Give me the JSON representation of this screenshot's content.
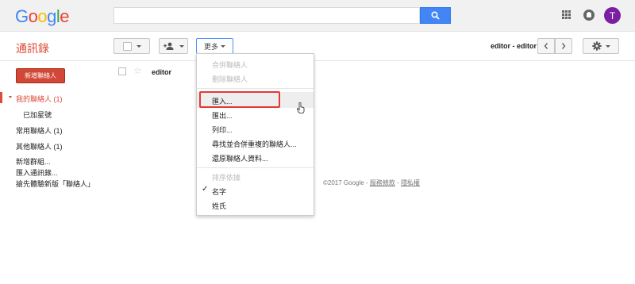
{
  "header": {
    "logo": [
      "G",
      "o",
      "o",
      "g",
      "l",
      "e"
    ],
    "logo_colors": [
      "#4285f4",
      "#ea4335",
      "#fbbc05",
      "#4285f4",
      "#34a853",
      "#ea4335"
    ],
    "search_placeholder": "",
    "avatar_letter": "T"
  },
  "toolbar": {
    "app_title": "通訊錄",
    "more_label": "更多",
    "editor_label": "editor - editor"
  },
  "sidebar": {
    "new_contact": "新增聯絡人",
    "items": [
      {
        "label": "我的聯絡人 (1)",
        "selected": true
      },
      {
        "label": "已加星號"
      },
      {
        "label": "常用聯絡人 (1)"
      },
      {
        "label": "其他聯絡人 (1)"
      },
      {
        "label": "新增群組..."
      },
      {
        "label": "匯入通訊錄..."
      },
      {
        "label": "搶先體驗新版「聯絡人」"
      }
    ]
  },
  "list": {
    "rows": [
      {
        "name": "editor"
      }
    ]
  },
  "menu": {
    "items": [
      {
        "label": "合併聯絡人",
        "disabled": true
      },
      {
        "label": "刪除聯絡人",
        "disabled": true
      },
      {
        "label": "匯入..."
      },
      {
        "label": "匯出..."
      },
      {
        "label": "列印..."
      },
      {
        "label": "尋找並合併重複的聯絡人..."
      },
      {
        "label": "還原聯絡人資料..."
      },
      {
        "label": "排序依據",
        "disabled": true
      },
      {
        "label": "名字",
        "checked": true
      },
      {
        "label": "姓氏"
      }
    ]
  },
  "footer": {
    "copyright": "©2017 Google - ",
    "terms": "服務條款",
    "sep": " - ",
    "privacy": "隱私權"
  },
  "colors": {
    "accent_red": "#dd4b39",
    "button_red": "#d14836",
    "search_blue": "#4285f4",
    "highlight_red": "#e53935"
  }
}
